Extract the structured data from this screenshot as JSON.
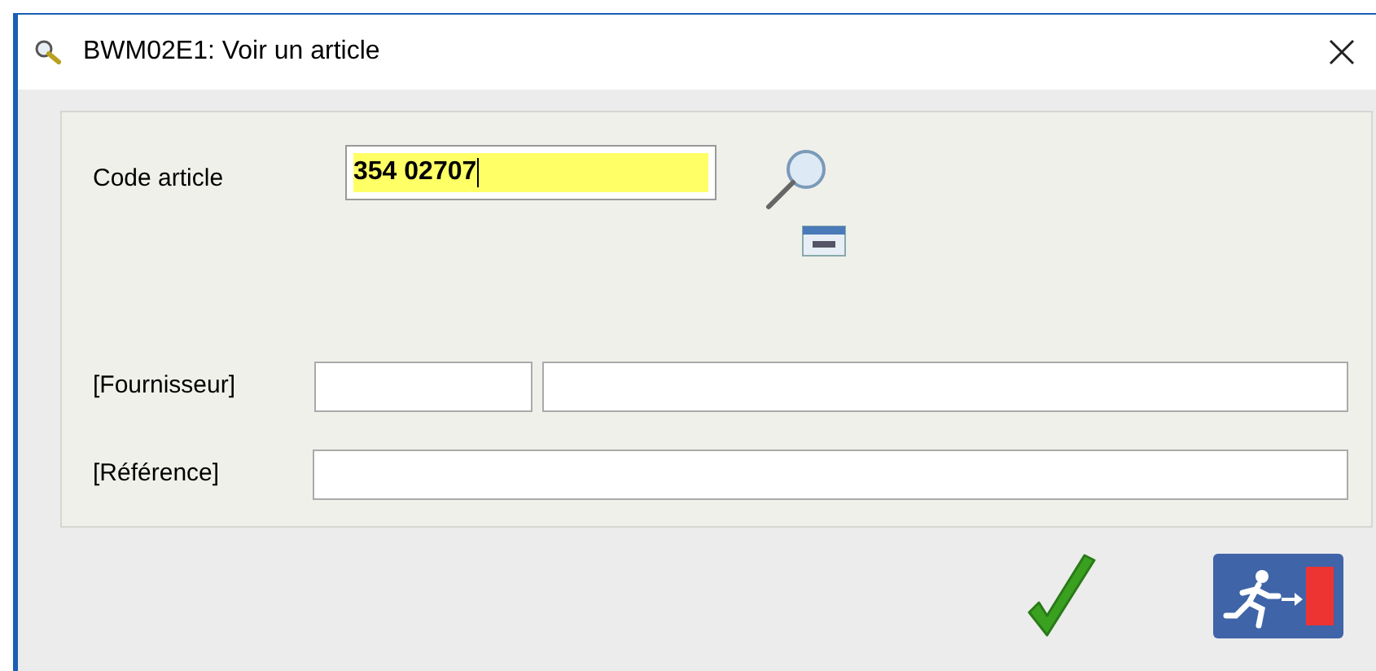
{
  "window": {
    "title": "BWM02E1: Voir un article"
  },
  "code_article": {
    "label": "Code article",
    "value": "354 02707"
  },
  "fournisseur": {
    "label": "[Fournisseur]"
  },
  "reference": {
    "label": "[Référence]"
  }
}
